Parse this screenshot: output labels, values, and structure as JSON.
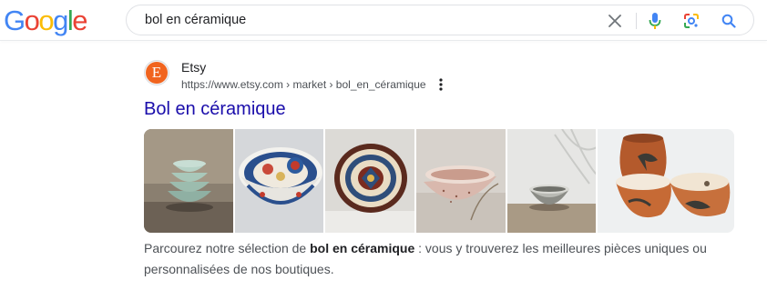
{
  "logo": {
    "letters": [
      "G",
      "o",
      "o",
      "g",
      "l",
      "e"
    ],
    "colors": [
      "#4285f4",
      "#ea4335",
      "#fbbc05",
      "#4285f4",
      "#34a853",
      "#ea4335"
    ]
  },
  "search": {
    "query": "bol en céramique"
  },
  "icons": {
    "clear": "close-icon",
    "voice": "microphone-icon",
    "lens": "google-lens-icon",
    "search": "search-icon",
    "more": "more-vert-icon"
  },
  "result": {
    "favicon_letter": "E",
    "site_name": "Etsy",
    "url": "https://www.etsy.com › market › bol_en_céramique",
    "title": "Bol en céramique",
    "snippet_before": "Parcourez notre sélection de ",
    "snippet_bold": "bol en céramique",
    "snippet_after": " : vous y trouverez les meilleures pièces uniques ou personnalisées de nos boutiques."
  },
  "colors": {
    "link": "#1a0dab",
    "etsy_orange": "#f1641e",
    "text": "#4d5156"
  },
  "thumbnails": [
    {
      "name": "stacked celadon bowls"
    },
    {
      "name": "imari style bowl"
    },
    {
      "name": "moroccan patterned bowl"
    },
    {
      "name": "pink speckled bowl"
    },
    {
      "name": "grey white glaze bowl"
    },
    {
      "name": "terracotta painted bowls"
    }
  ]
}
